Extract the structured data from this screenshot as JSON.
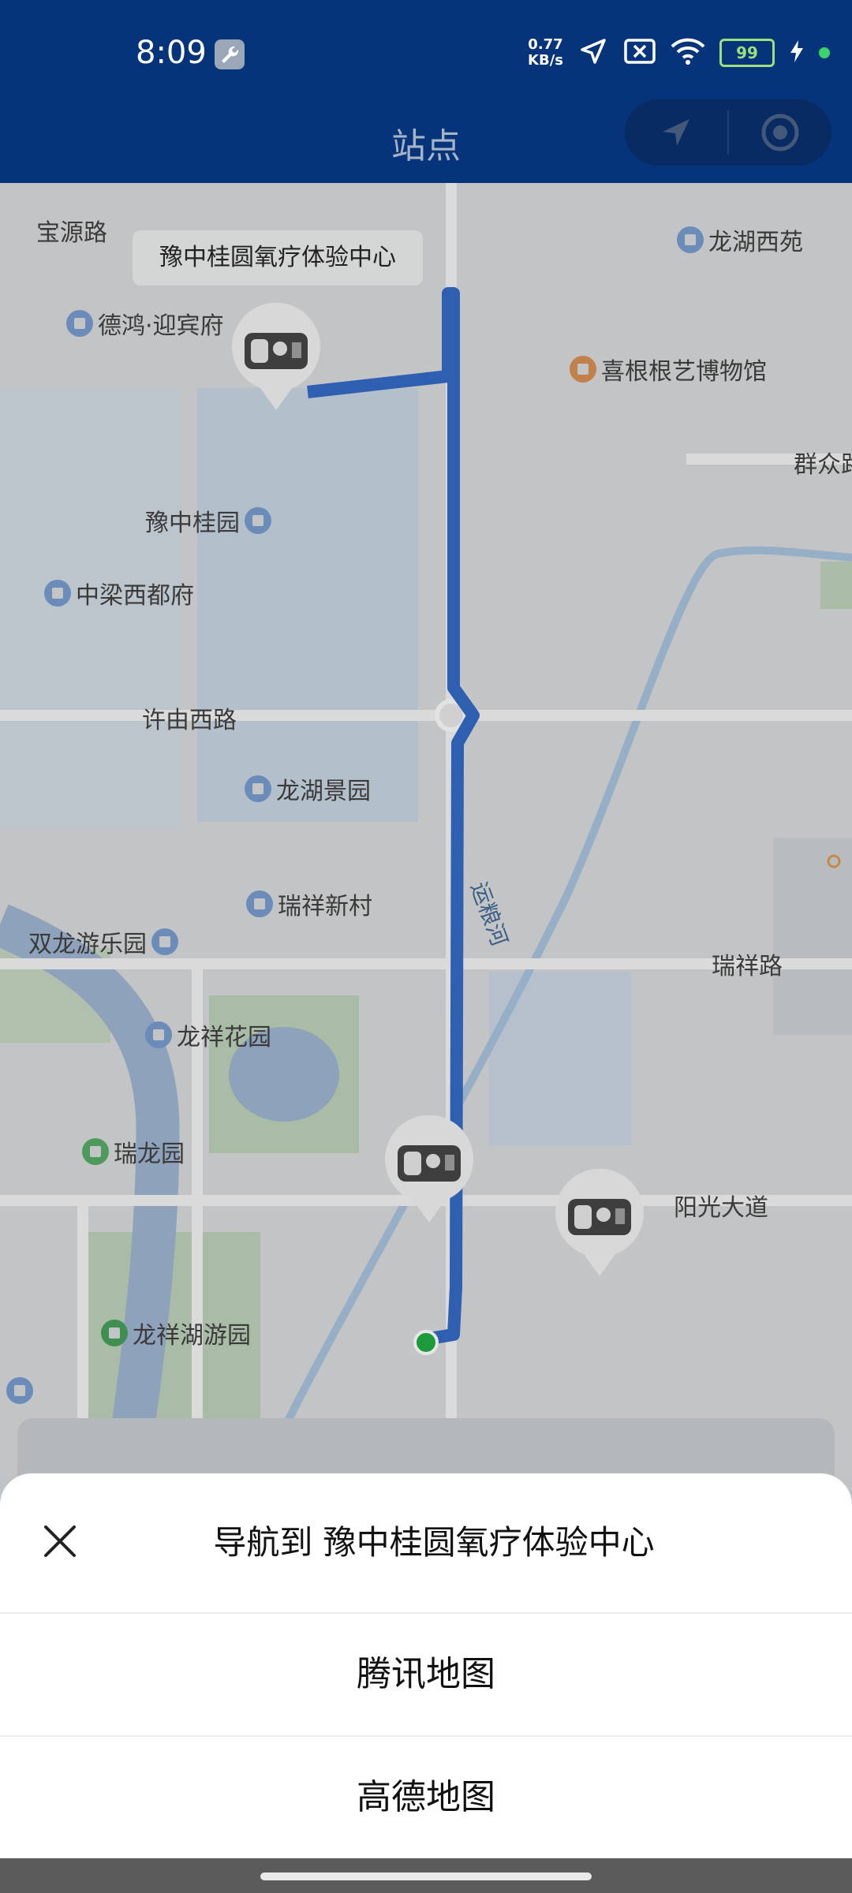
{
  "status_bar": {
    "time": "8:09",
    "network_speed_value": "0.77",
    "network_speed_unit": "KB/s",
    "battery": "99"
  },
  "header": {
    "title": "站点"
  },
  "map": {
    "callout": "豫中桂圆氧疗体验中心",
    "road_labels": [
      "宝源路",
      "许由西路",
      "瑞祥路",
      "阳光大道",
      "群众路",
      "运粮河"
    ],
    "pois": [
      "龙湖西苑",
      "德鸿·迎宾府",
      "喜根根艺博物馆",
      "豫中桂园",
      "中梁西都府",
      "龙湖景园",
      "瑞祥新村",
      "双龙游乐园",
      "龙祥花园",
      "瑞龙园",
      "龙祥湖游园"
    ]
  },
  "sheet": {
    "title": "导航到 豫中桂圆氧疗体验中心",
    "options": [
      "腾讯地图",
      "高德地图"
    ]
  },
  "colors": {
    "header_bg": "#06347a",
    "route": "#2f5fb0",
    "sheet_bg": "#ffffff"
  }
}
